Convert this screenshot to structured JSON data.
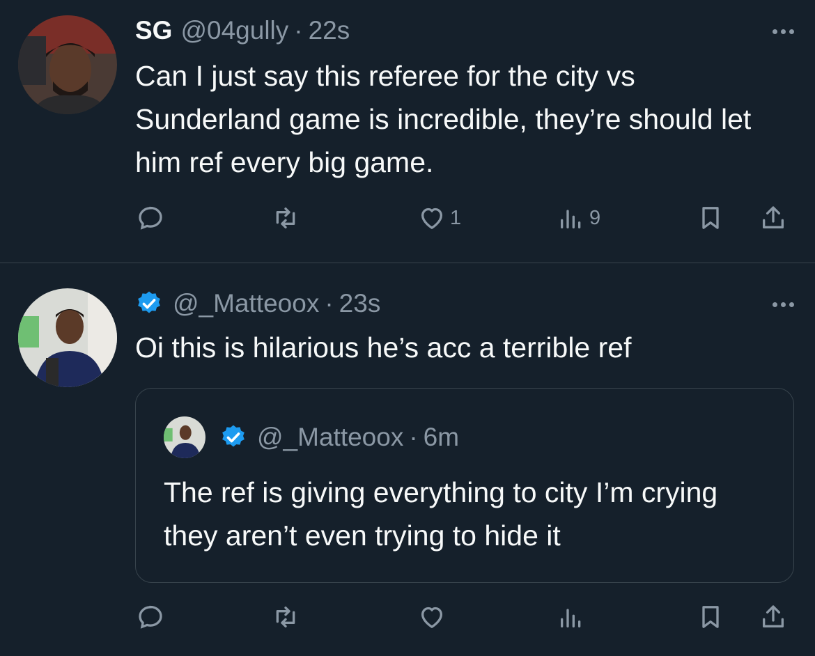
{
  "tweets": [
    {
      "name": "SG",
      "handle": "@04gully",
      "separator": "·",
      "time": "22s",
      "text": "Can I just say this referee for the city vs Sunderland game is incredible, they’re should let him ref every big game.",
      "likes": "1",
      "views": "9"
    },
    {
      "handle": "@_Matteoox",
      "separator": "·",
      "time": "23s",
      "text": "Oi this is hilarious he’s acc a terrible ref",
      "quote": {
        "handle": "@_Matteoox",
        "separator": "·",
        "time": "6m",
        "text": "The ref is giving everything to city I’m crying they aren’t even trying to hide it"
      }
    }
  ],
  "icons": [
    "more-icon",
    "verified-badge-icon",
    "reply-icon",
    "retweet-icon",
    "like-icon",
    "views-icon",
    "bookmark-icon",
    "share-icon"
  ],
  "colors": {
    "background": "#15202b",
    "text": "#f7f9f9",
    "muted": "#8b98a5",
    "verified": "#1d9bf0",
    "divider": "#38444d"
  }
}
